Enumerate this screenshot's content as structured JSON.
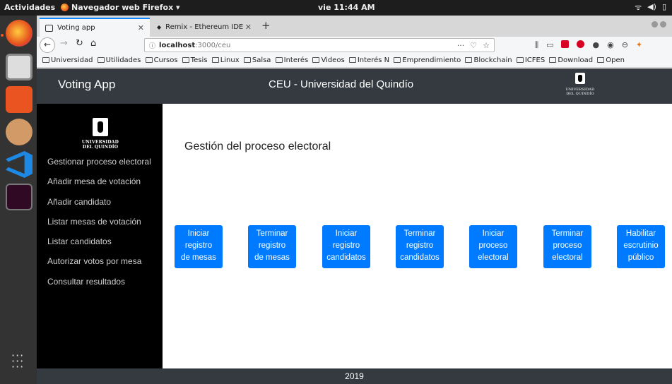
{
  "system_bar": {
    "activities": "Actividades",
    "app_name": "Navegador web Firefox ▾",
    "clock": "vie 11:44 AM"
  },
  "browser": {
    "tabs": [
      {
        "label": "Voting app",
        "active": true
      },
      {
        "label": "Remix - Ethereum IDE",
        "active": false
      }
    ],
    "url_host": "localhost",
    "url_path": ":3000/ceu",
    "bookmarks": [
      "Universidad",
      "Utilidades",
      "Cursos",
      "Tesis",
      "Linux",
      "Salsa",
      "Interés",
      "Videos",
      "Interés N",
      "Emprendimiento",
      "Blockchain",
      "ICFES",
      "Download",
      "Open"
    ]
  },
  "header": {
    "brand": "Voting App",
    "center_title": "CEU - Universidad del Quindío",
    "logo_line1": "UNIVERSIDAD",
    "logo_line2": "DEL QUINDÍO"
  },
  "sidebar": {
    "logo_line1": "UNIVERSIDAD",
    "logo_line2": "DEL QUINDÍO",
    "items": [
      "Gestionar proceso electoral",
      "Añadir mesa de votación",
      "Añadir candidato",
      "Listar mesas de votación",
      "Listar candidatos",
      "Autorizar votos por mesa",
      "Consultar resultados"
    ]
  },
  "main": {
    "heading": "Gestión del proceso electoral",
    "buttons": [
      {
        "l1": "Iniciar",
        "l2": "registro",
        "l3": "de mesas"
      },
      {
        "l1": "Terminar",
        "l2": "registro",
        "l3": "de mesas"
      },
      {
        "l1": "Iniciar",
        "l2": "registro",
        "l3": "candidatos"
      },
      {
        "l1": "Terminar",
        "l2": "registro",
        "l3": "candidatos"
      },
      {
        "l1": "Iniciar",
        "l2": "proceso",
        "l3": "electoral"
      },
      {
        "l1": "Terminar",
        "l2": "proceso",
        "l3": "electoral"
      },
      {
        "l1": "Habilitar",
        "l2": "escrutinio",
        "l3": "público"
      }
    ]
  },
  "footer": {
    "text": "2019"
  },
  "colors": {
    "primary": "#007bff",
    "navbar": "#343a40",
    "sidebar": "#000000"
  }
}
